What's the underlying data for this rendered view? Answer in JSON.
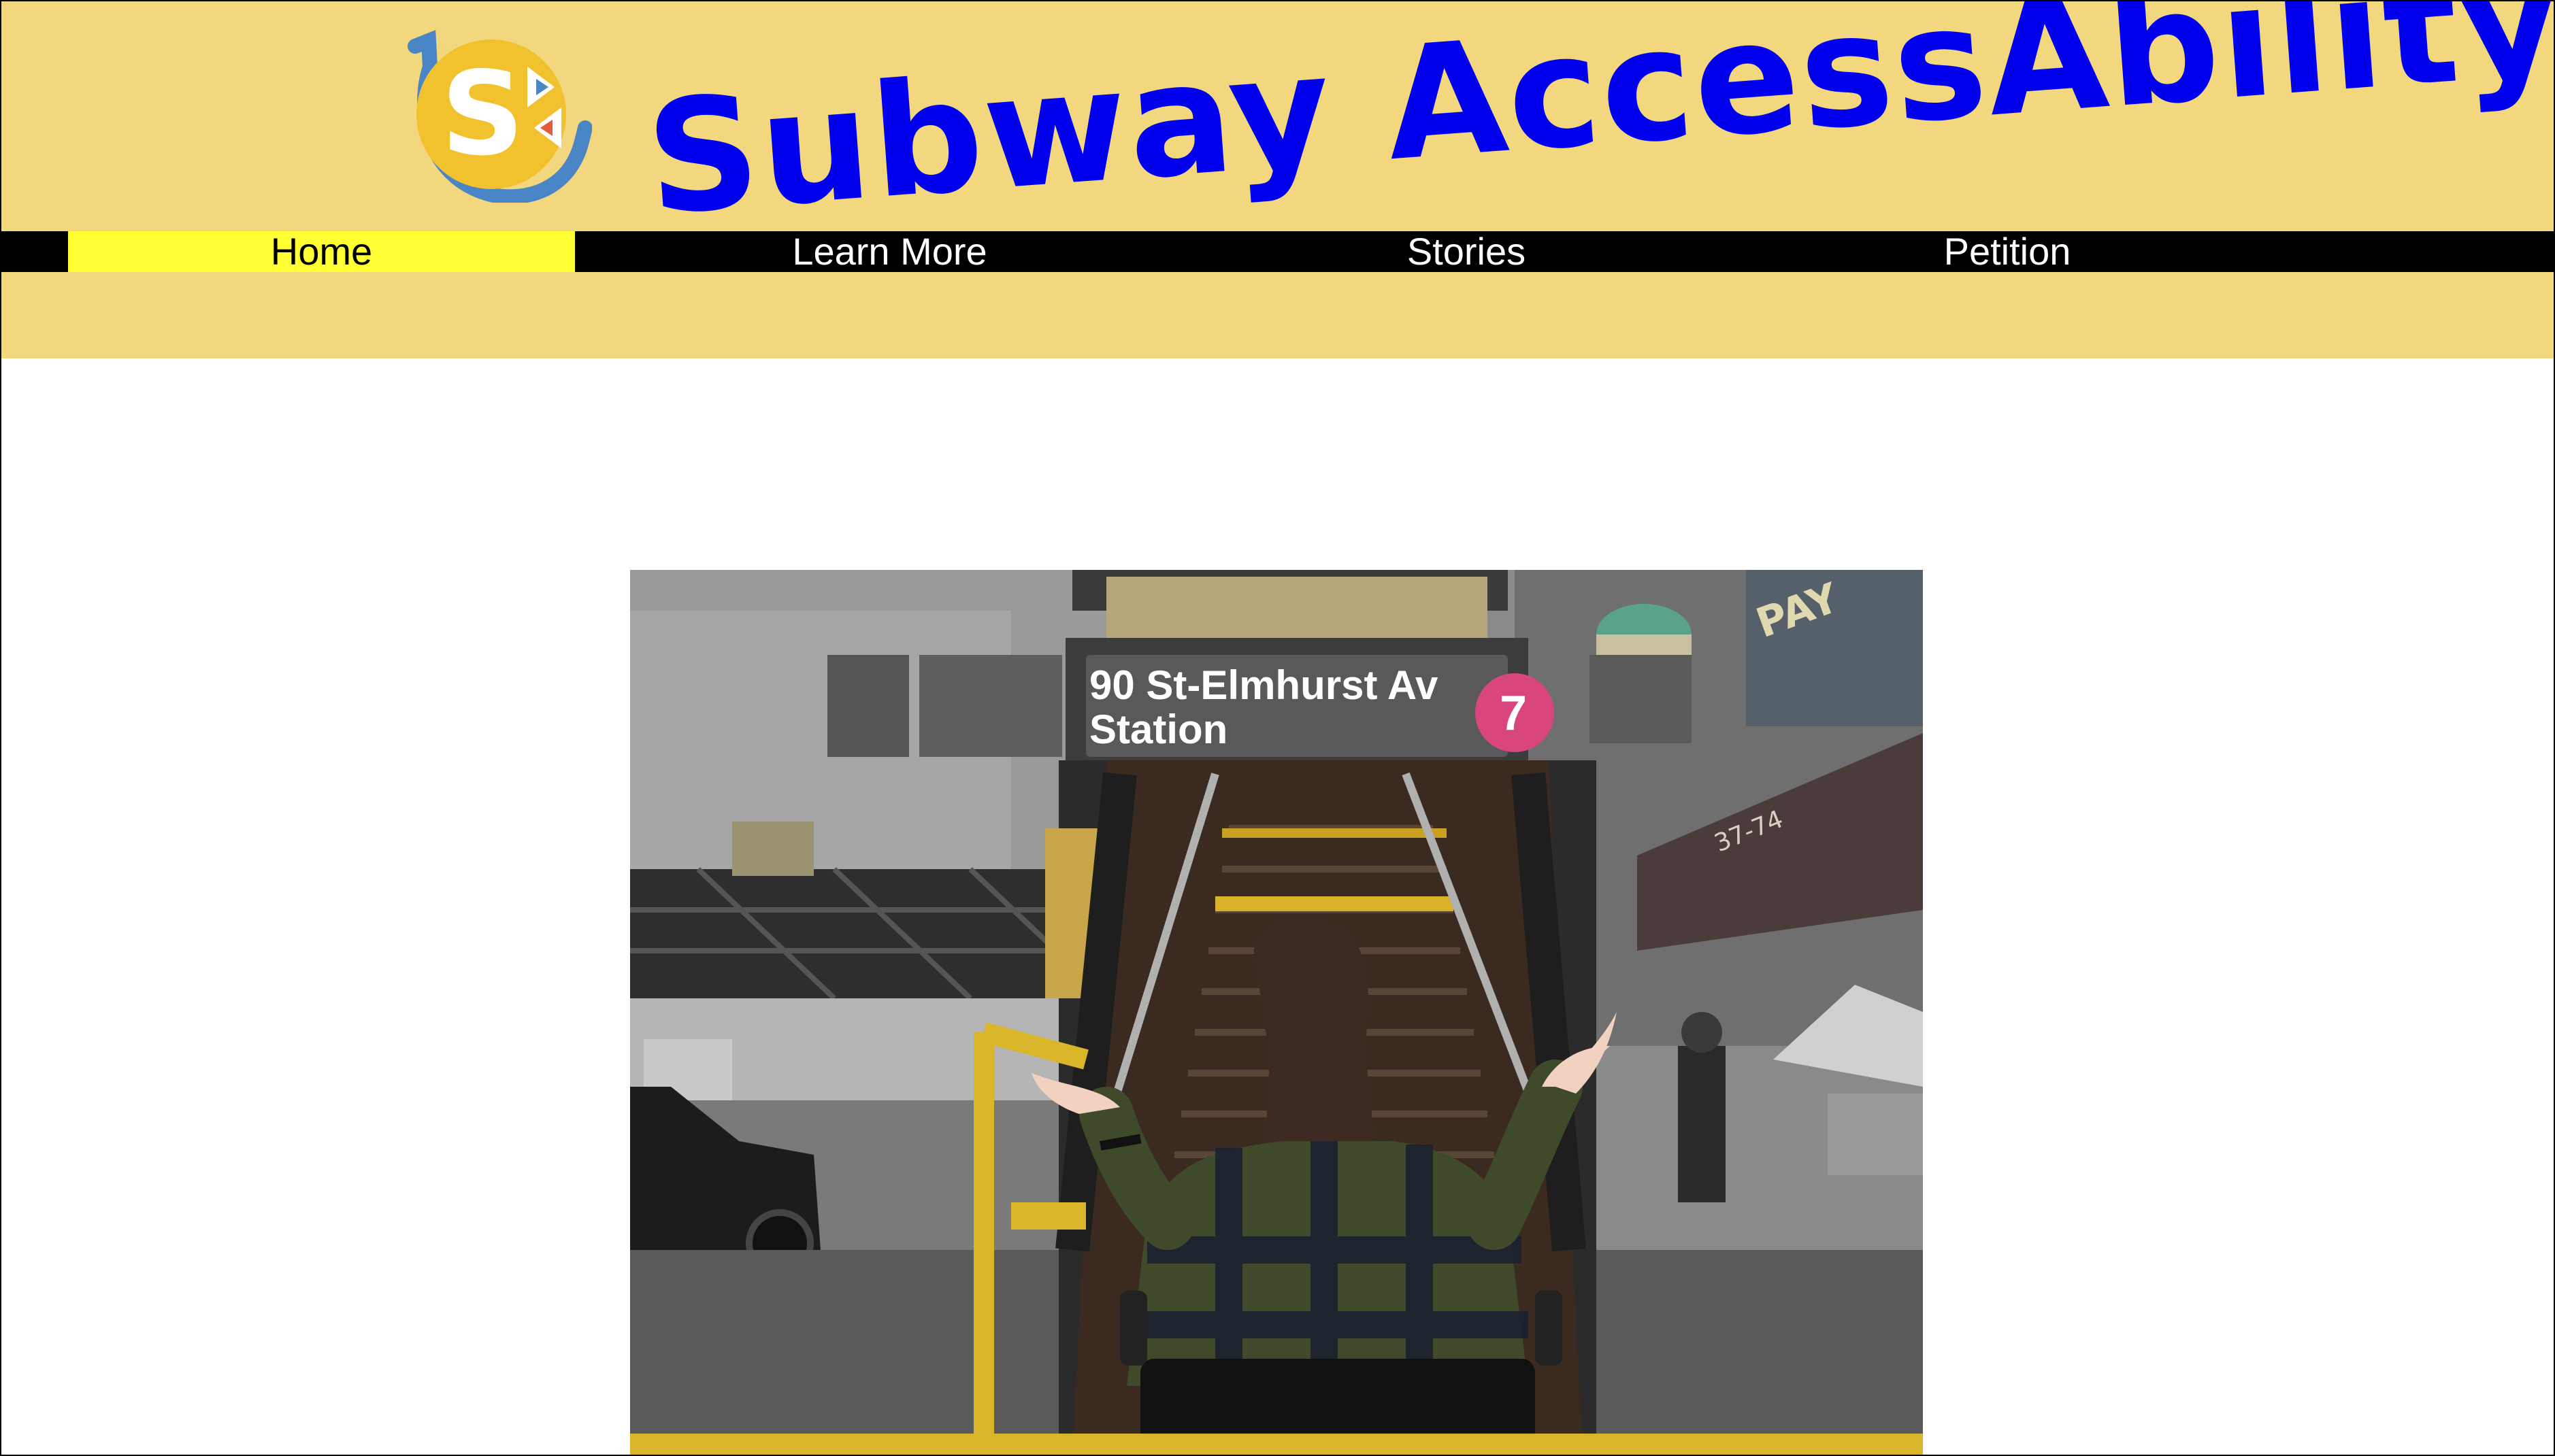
{
  "site": {
    "title": "Subway AccessAbility",
    "logo_icon": "subway-accessability-logo-icon"
  },
  "nav": {
    "items": [
      {
        "label": "Home",
        "active": true
      },
      {
        "label": "Learn More",
        "active": false
      },
      {
        "label": "Stories",
        "active": false
      },
      {
        "label": "Petition",
        "active": false
      }
    ]
  },
  "hero": {
    "sign_line1": "90 St-Elmhurst Av",
    "sign_line2": "Station",
    "route_badge": "7",
    "address": "37-74"
  },
  "colors": {
    "header_bg": "#f2d77f",
    "title_blue": "#0000ee",
    "nav_bg": "#000000",
    "nav_active": "#ffff33",
    "logo_gold": "#f2c12e",
    "logo_blue": "#4a86c5",
    "route_7_pink": "#d9467e"
  }
}
